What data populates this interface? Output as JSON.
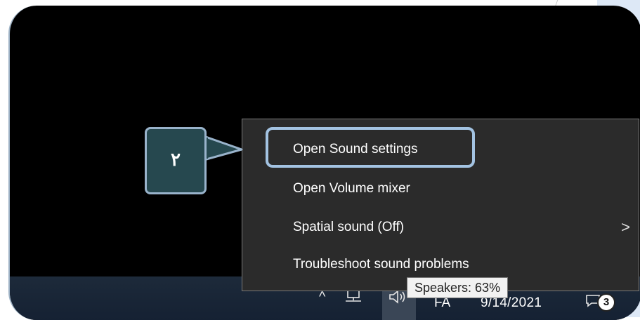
{
  "callout": {
    "number": "۲"
  },
  "context_menu": {
    "items": [
      {
        "label": "Open Sound settings",
        "highlighted": true
      },
      {
        "label": "Open Volume mixer"
      },
      {
        "label": "Spatial sound (Off)",
        "submenu_arrow": ">"
      },
      {
        "label": "Troubleshoot sound problems"
      }
    ]
  },
  "tooltip": {
    "text": "Speakers: 63%"
  },
  "taskbar": {
    "chevron": "^",
    "language": "FA",
    "date": "9/14/2021",
    "notification_count": "3",
    "icons": [
      "chevron-up-icon",
      "network-icon",
      "volume-icon",
      "notification-icon"
    ]
  },
  "colors": {
    "menu_bg": "#2b2b2b",
    "highlight_border": "#a3c3e2",
    "callout_bg": "#26484f",
    "taskbar_bg": "#1d2a3a"
  }
}
